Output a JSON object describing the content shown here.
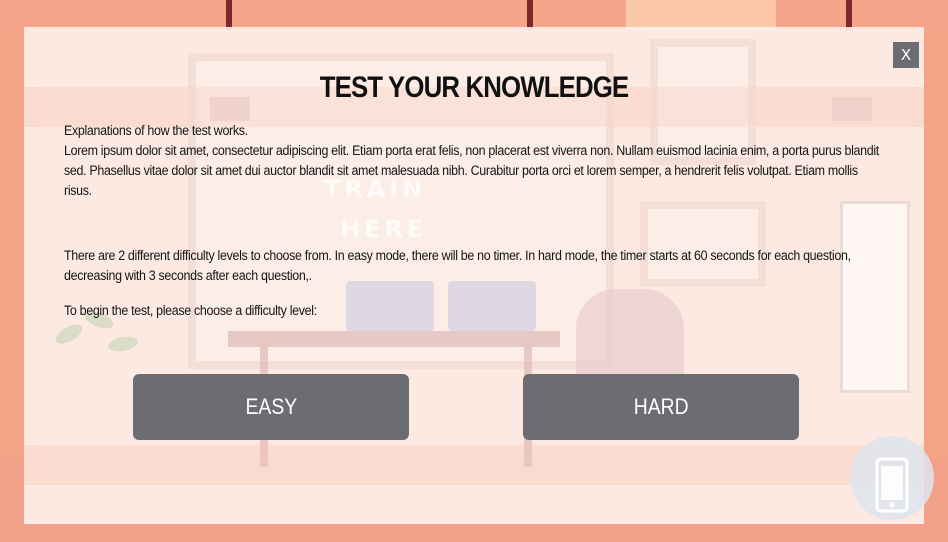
{
  "dialog": {
    "title": "TEST YOUR KNOWLEDGE",
    "close_label": "X",
    "intro_heading": "Explanations of how the test works.",
    "intro_body": "Lorem ipsum dolor sit amet, consectetur adipiscing elit. Etiam porta erat felis, non placerat est viverra non. Nullam euismod lacinia enim, a porta purus blandit sed. Phasellus vitae dolor sit amet dui auctor blandit sit amet malesuada nibh. Curabitur porta orci et lorem semper, a hendrerit felis volutpat. Etiam mollis risus.",
    "difficulty_info": "There are 2 different difficulty levels to choose from. In easy mode, there will be no timer. In hard mode, the timer starts at 60 seconds for each question, decreasing with 3 seconds after each question,.",
    "prompt": "To begin the test, please choose a difficulty level:",
    "buttons": {
      "easy": "EASY",
      "hard": "HARD"
    }
  },
  "background": {
    "sign_line1": "TRAIN",
    "sign_line2": "HERE"
  },
  "icons": {
    "close": "close-icon",
    "phone": "mobile-phone-icon"
  },
  "colors": {
    "button_bg": "#6b6d72",
    "button_text": "#ffffff",
    "frame": "#f6a88e",
    "panel": "#fdf1eb"
  }
}
